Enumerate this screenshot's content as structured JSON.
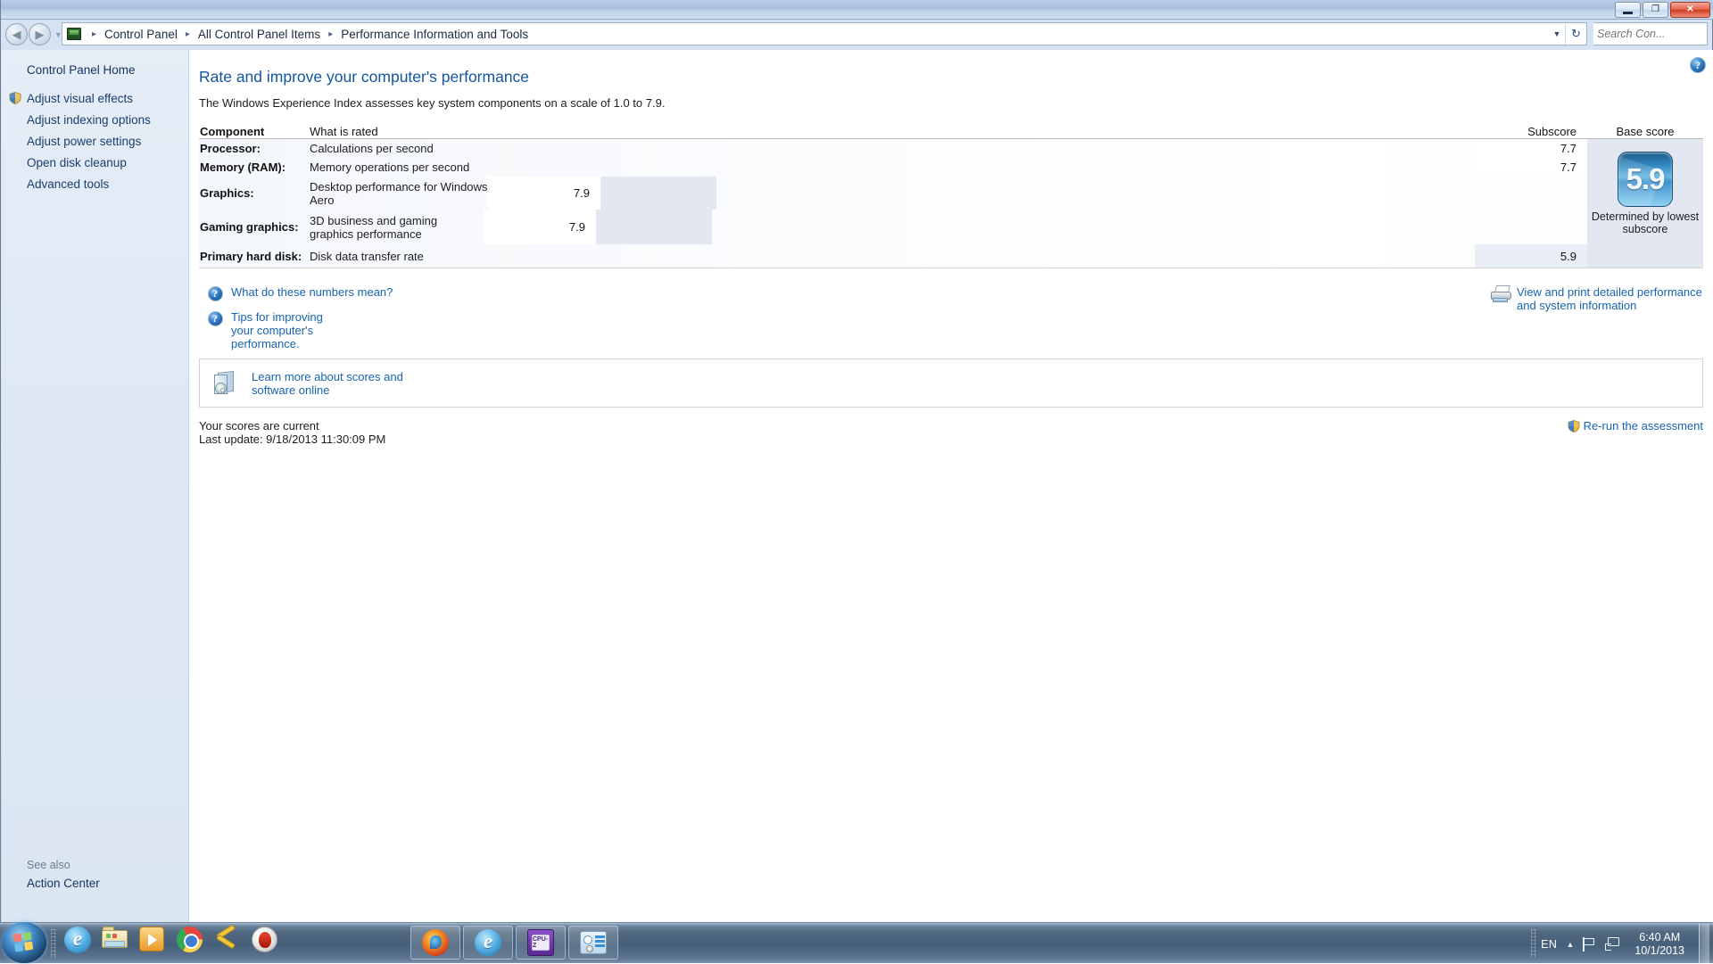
{
  "window": {
    "minimize_label": "Minimize",
    "maximize_label": "Restore",
    "close_label": "Close"
  },
  "nav": {
    "back_label": "Back",
    "forward_label": "Forward",
    "recent_label": "Recent pages",
    "refresh_label": "Refresh",
    "history_label": "Previous locations"
  },
  "breadcrumb": {
    "icon": "control-panel-icon",
    "items": [
      "Control Panel",
      "All Control Panel Items",
      "Performance Information and Tools"
    ],
    "separator": "▸"
  },
  "search": {
    "placeholder": "Search Con...",
    "value": "",
    "icon": "search-icon"
  },
  "sidebar": {
    "home_label": "Control Panel Home",
    "items": [
      {
        "label": "Adjust visual effects",
        "icon": "uac-shield-icon"
      },
      {
        "label": "Adjust indexing options",
        "icon": ""
      },
      {
        "label": "Adjust power settings",
        "icon": ""
      },
      {
        "label": "Open disk cleanup",
        "icon": ""
      },
      {
        "label": "Advanced tools",
        "icon": ""
      }
    ],
    "see_also_label": "See also",
    "see_also_items": [
      "Action Center"
    ]
  },
  "content": {
    "help_icon": "help-icon",
    "title": "Rate and improve your computer's performance",
    "subtitle": "The Windows Experience Index assesses key system components on a scale of 1.0 to 7.9."
  },
  "table": {
    "headers": {
      "component": "Component",
      "what_is_rated": "What is rated",
      "subscore": "Subscore",
      "base_score": "Base score"
    },
    "rows": [
      {
        "component": "Processor:",
        "what_is_rated": "Calculations per second",
        "subscore": "7.7"
      },
      {
        "component": "Memory (RAM):",
        "what_is_rated": "Memory operations per second",
        "subscore": "7.7"
      },
      {
        "component": "Graphics:",
        "what_is_rated": "Desktop performance for Windows Aero",
        "subscore": "7.9"
      },
      {
        "component": "Gaming graphics:",
        "what_is_rated": "3D business and gaming graphics performance",
        "subscore": "7.9"
      },
      {
        "component": "Primary hard disk:",
        "what_is_rated": "Disk data transfer rate",
        "subscore": "5.9"
      }
    ],
    "base_score": "5.9",
    "base_caption": "Determined by lowest subscore"
  },
  "links": {
    "what_do_numbers_mean": "What do these numbers mean?",
    "tips_for_improving": "Tips for improving your computer's performance.",
    "view_and_print": "View and print detailed performance and system information",
    "learn_more": "Learn more about scores and software online"
  },
  "footer": {
    "status": "Your scores are current",
    "last_update": "Last update: 9/18/2013 11:30:09 PM",
    "rerun_label": "Re-run the assessment",
    "rerun_icon": "uac-shield-icon"
  },
  "taskbar": {
    "start_label": "Start",
    "quick_launch": [
      {
        "name": "internet-explorer-icon",
        "label": "Internet Explorer"
      },
      {
        "name": "windows-explorer-icon",
        "label": "Windows Explorer"
      },
      {
        "name": "media-player-icon",
        "label": "Windows Media Player"
      },
      {
        "name": "chrome-icon",
        "label": "Google Chrome"
      },
      {
        "name": "tools-icon",
        "label": "Tools"
      },
      {
        "name": "nero-icon",
        "label": "Nero"
      }
    ],
    "pinned": [
      {
        "name": "firefox-icon",
        "label": "Mozilla Firefox"
      },
      {
        "name": "internet-explorer-icon",
        "label": "Internet Explorer"
      },
      {
        "name": "cpuz-icon",
        "label": "CPU-Z"
      },
      {
        "name": "control-panel-icon",
        "label": "Performance Information and Tools"
      }
    ],
    "tray": {
      "language": "EN",
      "show_hidden_label": "Show hidden icons",
      "flag_label": "Action Center",
      "network_label": "Network",
      "time": "6:40 AM",
      "date": "10/1/2013",
      "show_desktop_label": "Show desktop"
    }
  }
}
